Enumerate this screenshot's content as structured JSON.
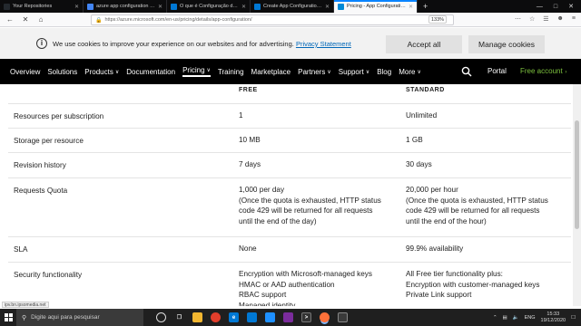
{
  "browser": {
    "tabs": [
      {
        "title": "Your Repositories",
        "icon": "github-icon",
        "color": "#24292e",
        "active": false
      },
      {
        "title": "azure app configuration - Pesq",
        "icon": "google-icon",
        "color": "#4285f4",
        "active": false
      },
      {
        "title": "O que é Configuração de Apl",
        "icon": "microsoft-docs-icon",
        "color": "#0078d4",
        "active": false
      },
      {
        "title": "Create App Configuration - Mi",
        "icon": "microsoft-docs-icon",
        "color": "#0078d4",
        "active": false
      },
      {
        "title": "Pricing - App Configuration | M",
        "icon": "azure-icon",
        "color": "#0089d6",
        "active": true
      }
    ],
    "url": "https://azure.microsoft.com/en-us/pricing/details/app-configuration/",
    "zoom": "133%"
  },
  "cookie_banner": {
    "message": "We use cookies to improve your experience on our websites and for advertising.",
    "privacy_link": "Privacy Statement",
    "accept_label": "Accept all",
    "manage_label": "Manage cookies"
  },
  "nav": {
    "items": [
      {
        "label": "Overview",
        "has_menu": false
      },
      {
        "label": "Solutions",
        "has_menu": false
      },
      {
        "label": "Products",
        "has_menu": true
      },
      {
        "label": "Documentation",
        "has_menu": false
      },
      {
        "label": "Pricing",
        "has_menu": true,
        "active": true
      },
      {
        "label": "Training",
        "has_menu": false
      },
      {
        "label": "Marketplace",
        "has_menu": false
      },
      {
        "label": "Partners",
        "has_menu": true
      },
      {
        "label": "Support",
        "has_menu": true
      },
      {
        "label": "Blog",
        "has_menu": false
      },
      {
        "label": "More",
        "has_menu": true
      }
    ],
    "portal": "Portal",
    "free_account": "Free account"
  },
  "table": {
    "col_free": "FREE",
    "col_standard": "STANDARD",
    "rows": [
      {
        "label": "Resources per subscription",
        "free": [
          "1"
        ],
        "standard": [
          "Unlimited"
        ]
      },
      {
        "label": "Storage per resource",
        "free": [
          "10 MB"
        ],
        "standard": [
          "1 GB"
        ]
      },
      {
        "label": "Revision history",
        "free": [
          "7 days"
        ],
        "standard": [
          "30 days"
        ]
      },
      {
        "label": "Requests Quota",
        "free": [
          "1,000 per day",
          "(Once the quota is exhausted, HTTP status",
          "code 429 will be returned for all requests",
          "until the end of the day)"
        ],
        "standard": [
          "20,000 per hour",
          "(Once the quota is exhausted, HTTP status",
          "code 429 will be returned for all requests",
          "until the end of the hour)"
        ]
      },
      {
        "label": "SLA",
        "free": [
          "None"
        ],
        "standard": [
          "99.9% availability"
        ]
      },
      {
        "label": "Security functionality",
        "free": [
          "Encryption with Microsoft-managed keys",
          "HMAC or AAD authentication",
          "RBAC support",
          "Managed identity"
        ],
        "standard": [
          "All Free tier functionality plus:",
          "Encryption with customer-managed keys",
          "Private Link support"
        ]
      }
    ]
  },
  "status_url": "ipv.bn.ipsomedia.net",
  "taskbar": {
    "search_placeholder": "Digite aqui para pesquisar",
    "language": "ENG",
    "time": "15:33",
    "date": "19/12/2020"
  }
}
